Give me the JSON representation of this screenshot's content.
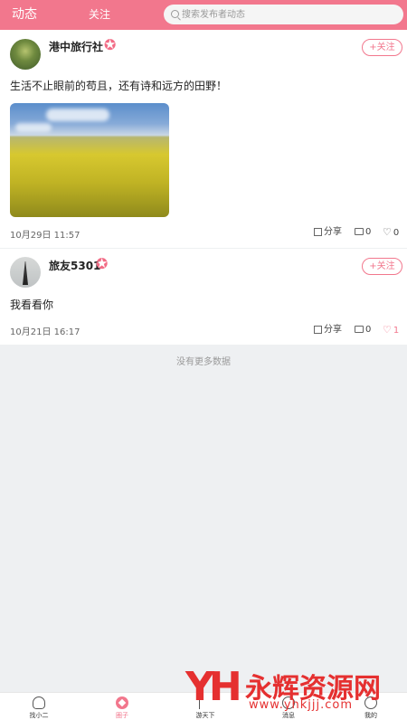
{
  "header": {
    "tab_dynamics": "动态",
    "tab_follow": "关注",
    "search_placeholder": "搜索发布者动态"
  },
  "posts": [
    {
      "author": "港中旅行社",
      "follow_label": "+关注",
      "content": "生活不止眼前的苟且，还有诗和远方的田野！",
      "has_image": true,
      "date": "10月29日 11:57",
      "share_label": "分享",
      "comments": "0",
      "likes": "0",
      "liked": false
    },
    {
      "author": "旅友5301",
      "follow_label": "+关注",
      "content": "我看看你",
      "has_image": false,
      "date": "10月21日 16:17",
      "share_label": "分享",
      "comments": "0",
      "likes": "1",
      "liked": true
    }
  ],
  "no_more": "没有更多数据",
  "tabbar": {
    "items": [
      {
        "label": "找小二",
        "icon": "people-icon",
        "active": false
      },
      {
        "label": "圈子",
        "icon": "compass-icon",
        "active": true
      },
      {
        "label": "游天下",
        "icon": "flag-icon",
        "active": false
      },
      {
        "label": "消息",
        "icon": "chat-icon",
        "active": false
      },
      {
        "label": "我的",
        "icon": "user-icon",
        "active": false
      }
    ]
  },
  "watermark": {
    "logo": "YH",
    "text": "永辉资源网",
    "url": "www.yhkjjj.com"
  },
  "colors": {
    "accent": "#f2778d",
    "background": "#eef0f2",
    "watermark": "#e53030"
  }
}
